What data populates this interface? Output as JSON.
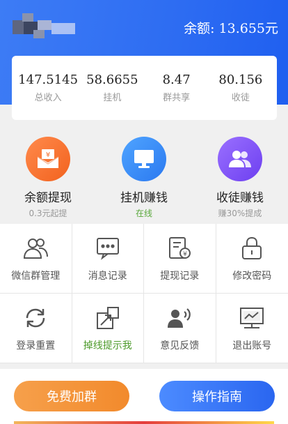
{
  "header": {
    "balance_label": "余额:",
    "balance_value": "13.655元"
  },
  "stats": [
    {
      "value": "147.5145",
      "label": "总收入"
    },
    {
      "value": "58.6655",
      "label": "挂机"
    },
    {
      "value": "8.47",
      "label": "群共享"
    },
    {
      "value": "80.156",
      "label": "收徒"
    }
  ],
  "features": [
    {
      "title": "余额提现",
      "sub": "0.3元起提",
      "icon": "wallet-icon",
      "color": "#f36d2a"
    },
    {
      "title": "挂机赚钱",
      "sub": "在线",
      "icon": "monitor-icon",
      "color": "#2f7df2"
    },
    {
      "title": "收徒赚钱",
      "sub": "赚30%提成",
      "icon": "users-icon",
      "color": "#7a4cf5"
    }
  ],
  "grid": [
    {
      "label": "微信群管理",
      "icon": "group-icon"
    },
    {
      "label": "消息记录",
      "icon": "message-icon"
    },
    {
      "label": "提现记录",
      "icon": "receipt-icon"
    },
    {
      "label": "修改密码",
      "icon": "lock-icon"
    },
    {
      "label": "登录重置",
      "icon": "refresh-icon"
    },
    {
      "label": "掉线提示我",
      "icon": "link-icon"
    },
    {
      "label": "意见反馈",
      "icon": "feedback-icon"
    },
    {
      "label": "退出账号",
      "icon": "chart-exit-icon"
    }
  ],
  "buttons": {
    "join_group": "免费加群",
    "guide": "操作指南"
  }
}
